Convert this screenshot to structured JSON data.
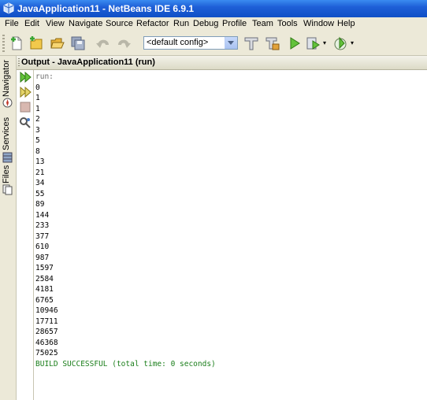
{
  "window": {
    "title": "JavaApplication11 - NetBeans IDE 6.9.1"
  },
  "menu": [
    "File",
    "Edit",
    "View",
    "Navigate",
    "Source",
    "Refactor",
    "Run",
    "Debug",
    "Profile",
    "Team",
    "Tools",
    "Window",
    "Help"
  ],
  "toolbar": {
    "config_value": "<default config>",
    "icons": [
      "new-file-icon",
      "new-project-icon",
      "open-project-icon",
      "save-all-icon",
      "undo-icon",
      "redo-icon",
      "clean-build-icon",
      "build-icon",
      "run-icon",
      "debug-icon",
      "profile-icon"
    ]
  },
  "sidebar": {
    "tabs": [
      "Navigator",
      "Services",
      "Files"
    ]
  },
  "output": {
    "header": "Output - JavaApplication11 (run)",
    "run_label": "run:",
    "lines": [
      "0",
      "1",
      "1",
      "2",
      "3",
      "5",
      "8",
      "13",
      "21",
      "34",
      "55",
      "89",
      "144",
      "233",
      "377",
      "610",
      "987",
      "1597",
      "2584",
      "4181",
      "6765",
      "10946",
      "17711",
      "28657",
      "46368",
      "75025"
    ],
    "status": "BUILD SUCCESSFUL (total time: 0 seconds)"
  },
  "colors": {
    "titlebar": "#1e5fd7",
    "chrome": "#ece9d8",
    "success": "#1a7e1a",
    "run_label": "#6e6e6e"
  }
}
